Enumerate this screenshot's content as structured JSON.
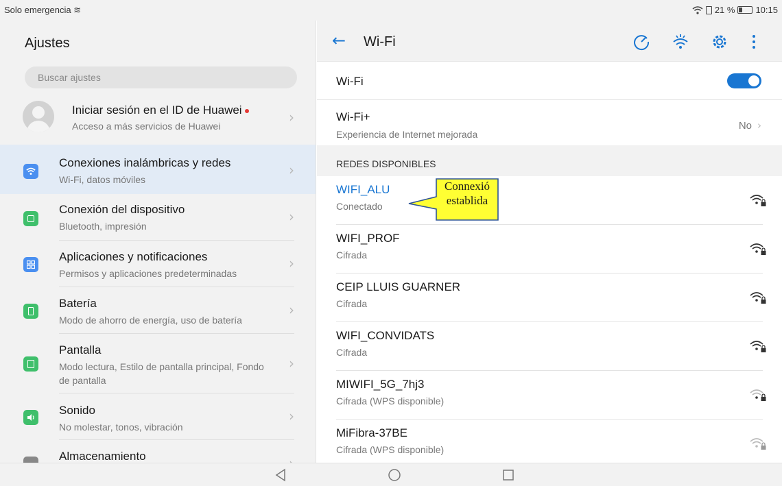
{
  "status_bar": {
    "carrier": "Solo emergencia",
    "battery": "21 %",
    "time": "10:15"
  },
  "left": {
    "title": "Ajustes",
    "search_placeholder": "Buscar ajustes",
    "account": {
      "title": "Iniciar sesión en el ID de Huawei",
      "subtitle": "Acceso a más servicios de Huawei"
    },
    "items": [
      {
        "title": "Conexiones inalámbricas y redes",
        "subtitle": "Wi-Fi, datos móviles",
        "icon": "wifi-icon",
        "color": "#4a8ff0",
        "selected": true
      },
      {
        "title": "Conexión del dispositivo",
        "subtitle": "Bluetooth, impresión",
        "icon": "device-connection-icon",
        "color": "#3fbf6b"
      },
      {
        "title": "Aplicaciones y notificaciones",
        "subtitle": "Permisos y aplicaciones predeterminadas",
        "icon": "apps-icon",
        "color": "#4a8ff0"
      },
      {
        "title": "Batería",
        "subtitle": "Modo de ahorro de energía, uso de batería",
        "icon": "battery-icon",
        "color": "#3fbf6b"
      },
      {
        "title": "Pantalla",
        "subtitle": "Modo lectura, Estilo de pantalla principal, Fondo de pantalla",
        "icon": "display-icon",
        "color": "#3fbf6b"
      },
      {
        "title": "Sonido",
        "subtitle": "No molestar, tonos, vibración",
        "icon": "sound-icon",
        "color": "#3fbf6b"
      },
      {
        "title": "Almacenamiento",
        "subtitle": "",
        "icon": "storage-icon",
        "color": "#888888"
      }
    ]
  },
  "right": {
    "title": "Wi-Fi",
    "wifi_label": "Wi-Fi",
    "wifi_on": true,
    "wifiplus": {
      "label": "Wi-Fi+",
      "subtitle": "Experiencia de Internet mejorada",
      "value": "No"
    },
    "section": "REDES DISPONIBLES",
    "networks": [
      {
        "name": "WIFI_ALU",
        "status": "Conectado",
        "connected": true,
        "signal": "strong"
      },
      {
        "name": "WIFI_PROF",
        "status": "Cifrada",
        "signal": "strong"
      },
      {
        "name": "CEIP LLUIS GUARNER",
        "status": "Cifrada",
        "signal": "strong"
      },
      {
        "name": "WIFI_CONVIDATS",
        "status": "Cifrada",
        "signal": "strong"
      },
      {
        "name": "MIWIFI_5G_7hj3",
        "status": "Cifrada (WPS disponible)",
        "signal": "weak"
      },
      {
        "name": "MiFibra-37BE",
        "status": "Cifrada (WPS disponible)",
        "signal": "weak"
      }
    ]
  },
  "annotation": {
    "line1": "Connexió",
    "line2": "establida"
  },
  "colors": {
    "accent": "#1976d2",
    "callout_fill": "#ffff33",
    "callout_border": "#2f5597"
  }
}
